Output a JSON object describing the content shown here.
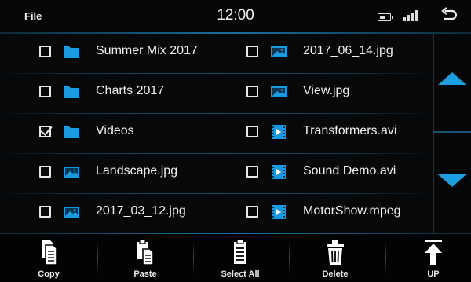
{
  "status": {
    "title": "File",
    "clock": "12:00"
  },
  "files": [
    {
      "name": "Summer Mix 2017",
      "type": "folder",
      "checked": false
    },
    {
      "name": "2017_06_14.jpg",
      "type": "image",
      "checked": false
    },
    {
      "name": "Charts 2017",
      "type": "folder",
      "checked": false
    },
    {
      "name": "View.jpg",
      "type": "image",
      "checked": false
    },
    {
      "name": "Videos",
      "type": "folder",
      "checked": true
    },
    {
      "name": "Transformers.avi",
      "type": "video",
      "checked": false
    },
    {
      "name": "Landscape.jpg",
      "type": "image",
      "checked": false
    },
    {
      "name": "Sound Demo.avi",
      "type": "video",
      "checked": false
    },
    {
      "name": "2017_03_12.jpg",
      "type": "image",
      "checked": false
    },
    {
      "name": "MotorShow.mpeg",
      "type": "video",
      "checked": false
    }
  ],
  "toolbar": {
    "copy": "Copy",
    "paste": "Paste",
    "select_all": "Select All",
    "delete": "Delete",
    "up": "UP"
  },
  "colors": {
    "accent": "#1c9ee0",
    "folder": "#1a9ae0",
    "background": "#060809"
  }
}
